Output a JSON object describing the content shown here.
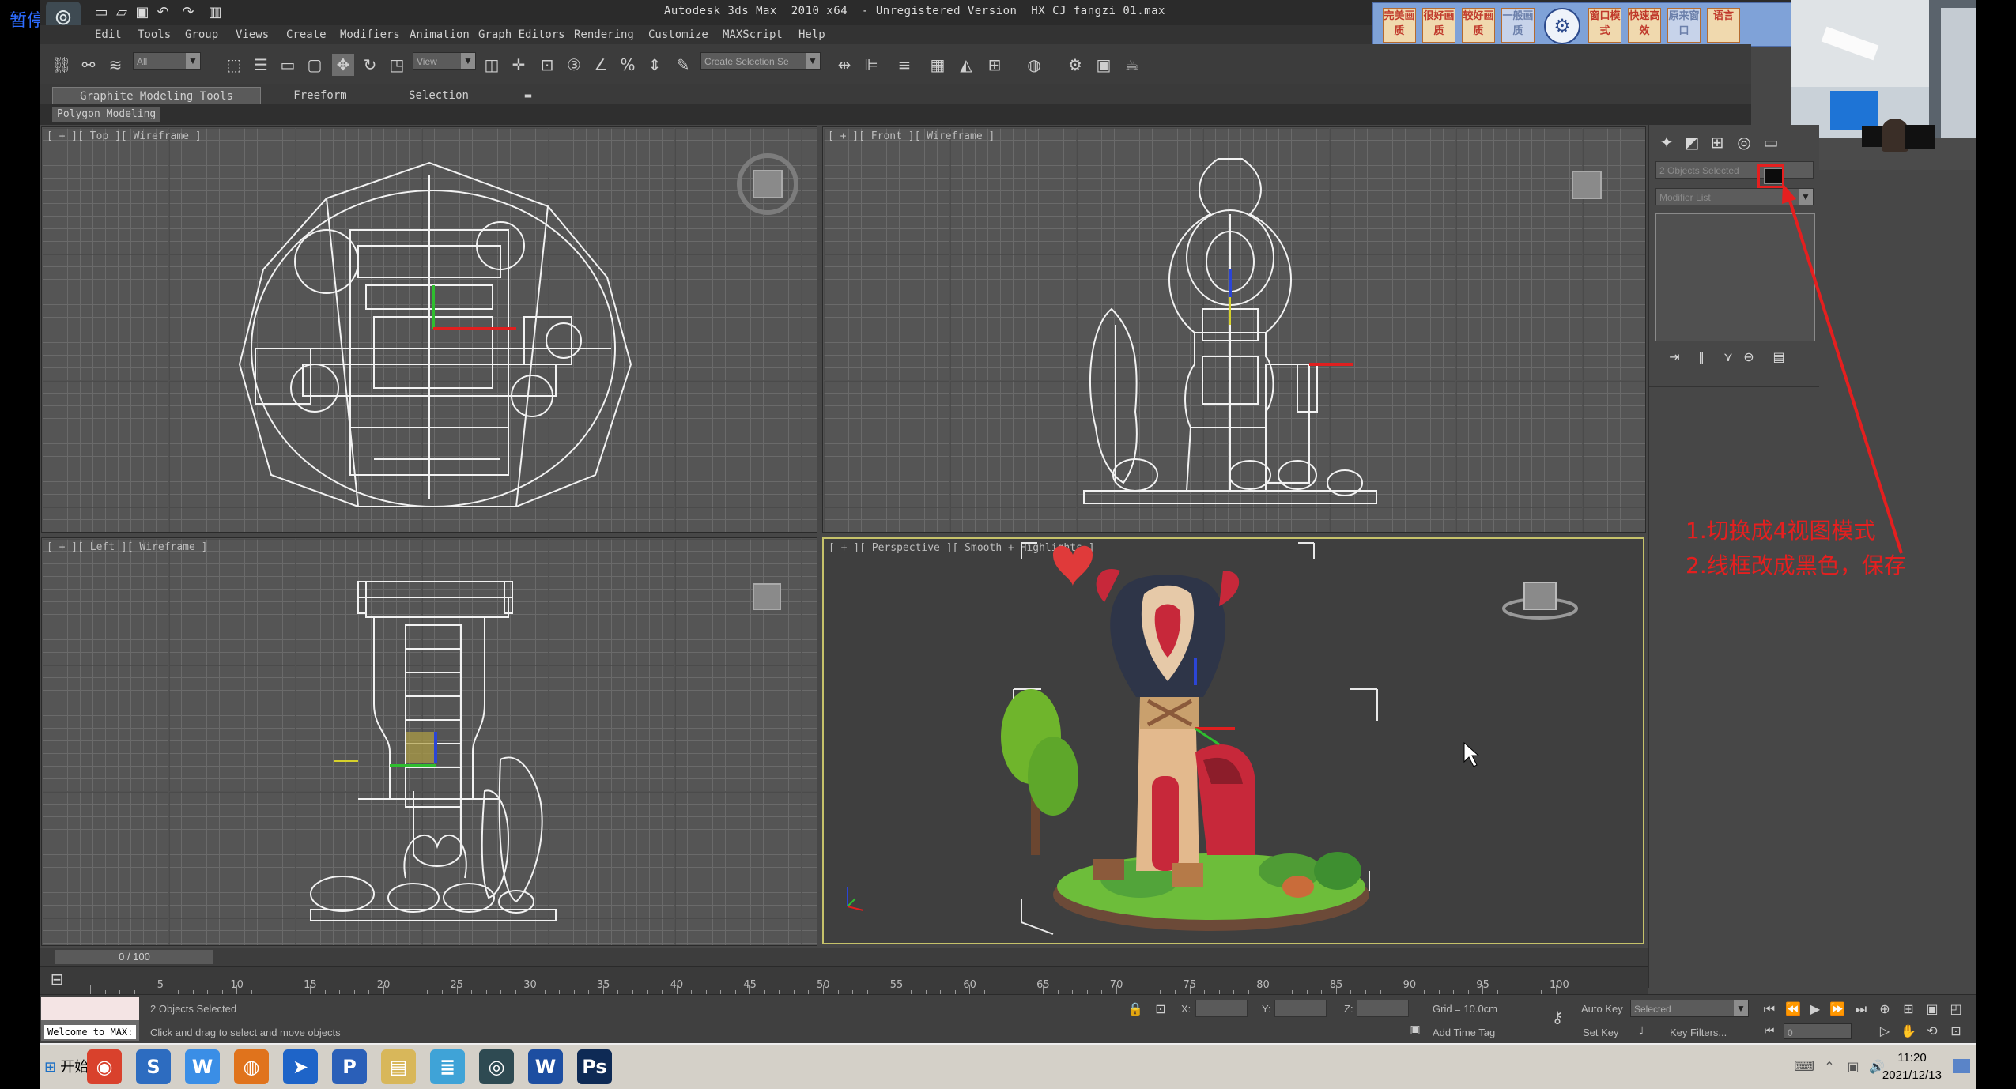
{
  "overlay": {
    "paused_label": "暂停"
  },
  "titlebar": {
    "title": "Autodesk 3ds Max  2010 x64  - Unregistered Version  HX_CJ_fangzi_01.max",
    "logo": "3ds-max-logo"
  },
  "menu": [
    "Edit",
    "Tools",
    "Group",
    "Views",
    "Create",
    "Modifiers",
    "Animation",
    "Graph Editors",
    "Rendering",
    "Customize",
    "MAXScript",
    "Help"
  ],
  "plugin_buttons": [
    "完美画质",
    "很好画质",
    "较好画质",
    "一般画质",
    "窗口模式",
    "快速高效",
    "原来窗口",
    "语言"
  ],
  "toolbar": {
    "filter_value": "All",
    "refcoord_value": "View",
    "selection_set_placeholder": "Create Selection Se"
  },
  "ribbon": {
    "tabs": [
      "Graphite Modeling Tools",
      "Freeform",
      "Selection"
    ],
    "sub_tab": "Polygon Modeling"
  },
  "viewports": {
    "top": "[ + ][ Top ][ Wireframe ]",
    "front": "[ + ][ Front ][ Wireframe ]",
    "left": "[ + ][ Left ][ Wireframe ]",
    "perspective": "[ + ][ Perspective ][ Smooth + Highlights ]"
  },
  "command_panel": {
    "name_field": "2 Objects Selected",
    "modifier_list": "Modifier List"
  },
  "annotation": {
    "line1": "1.切换成4视图模式",
    "line2": "2.线框改成黑色，保存"
  },
  "timeline": {
    "frame_counter": "0 / 100",
    "ticks": [
      "5",
      "10",
      "15",
      "20",
      "25",
      "30",
      "35",
      "40",
      "45",
      "50",
      "55",
      "60",
      "65",
      "70",
      "75",
      "80",
      "85",
      "90",
      "95",
      "100"
    ]
  },
  "status": {
    "listener_label": "Welcome to MAX:",
    "selection_info": "2 Objects Selected",
    "prompt": "Click and drag to select and move objects",
    "x_label": "X:",
    "y_label": "Y:",
    "z_label": "Z:",
    "grid": "Grid = 10.0cm",
    "add_time_tag": "Add Time Tag",
    "auto_key": "Auto Key",
    "set_key": "Set Key",
    "key_mode": "Selected",
    "key_filters": "Key Filters...",
    "frame_field": "0"
  },
  "taskbar": {
    "start": "开始",
    "apps": [
      {
        "name": "chrome-icon",
        "glyph": "◉",
        "color": "#d9412c"
      },
      {
        "name": "sogou-icon",
        "glyph": "S",
        "color": "#2d6cc0"
      },
      {
        "name": "wps-icon",
        "glyph": "W",
        "color": "#3a8ee6"
      },
      {
        "name": "firefox-icon",
        "glyph": "◍",
        "color": "#e0731c"
      },
      {
        "name": "feiji-icon",
        "glyph": "➤",
        "color": "#1e64c8"
      },
      {
        "name": "p-app-icon",
        "glyph": "P",
        "color": "#2a5fb8"
      },
      {
        "name": "folder-icon",
        "glyph": "▤",
        "color": "#d8b75a"
      },
      {
        "name": "notes-icon",
        "glyph": "≣",
        "color": "#3fa3d7"
      },
      {
        "name": "max-icon",
        "glyph": "◎",
        "color": "#2e4a52"
      },
      {
        "name": "word-icon",
        "glyph": "W",
        "color": "#1d4ea1"
      },
      {
        "name": "photoshop-icon",
        "glyph": "Ps",
        "color": "#0e2a55"
      }
    ],
    "time": "11:20",
    "date": "2021/12/13"
  },
  "colors": {
    "annotation": "#e51f1f",
    "active_viewport_border": "#c6c26a",
    "viewport_bg": "#555555"
  }
}
